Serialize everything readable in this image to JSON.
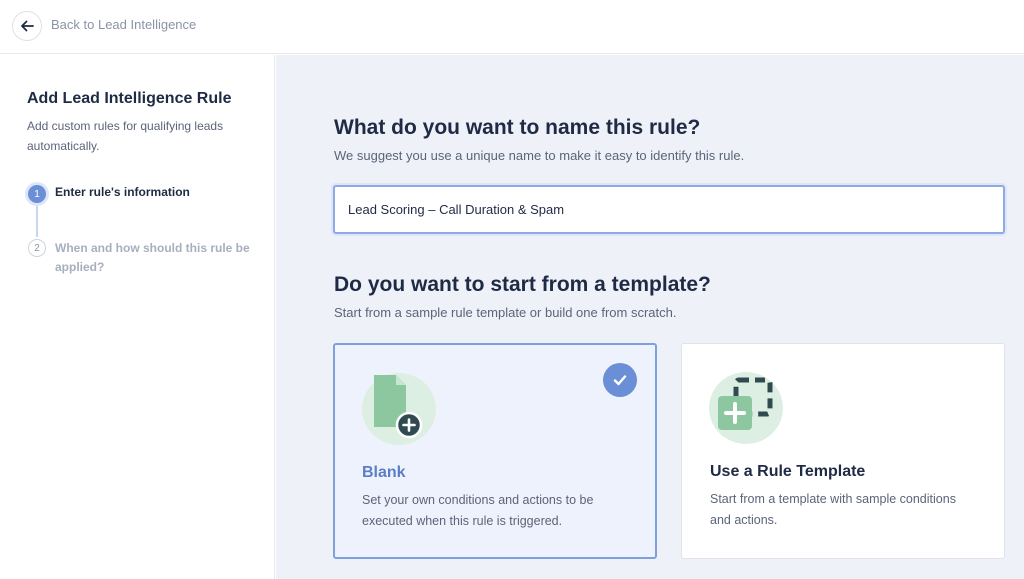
{
  "header": {
    "back_icon": "arrow-left-icon",
    "back_label": "Back to Lead Intelligence"
  },
  "sidebar": {
    "title": "Add Lead Intelligence Rule",
    "subtitle": "Add custom rules for qualifying leads automatically.",
    "steps": [
      {
        "number": "1",
        "label": "Enter rule's information",
        "state": "active"
      },
      {
        "number": "2",
        "label": "When and how should this rule be applied?",
        "state": "inactive"
      }
    ]
  },
  "main": {
    "name_section": {
      "heading": "What do you want to name this rule?",
      "description": "We suggest you use a unique name to make it easy to identify this rule.",
      "input_value": "Lead Scoring – Call Duration & Spam"
    },
    "template_section": {
      "heading": "Do you want to start from a template?",
      "description": "Start from a sample rule template or build one from scratch.",
      "options": [
        {
          "title": "Blank",
          "description": "Set your own conditions and actions to be executed when this rule is triggered.",
          "selected": true,
          "icon": "blank-document-plus-icon"
        },
        {
          "title": "Use a Rule Template",
          "description": "Start from a template with sample conditions and actions.",
          "selected": false,
          "icon": "template-plus-icon"
        }
      ]
    }
  },
  "colors": {
    "accent": "#6b8fd6",
    "accent_text": "#5b7ec7",
    "main_bg": "#eef1f8",
    "illustration_green": "#8cc7a0",
    "illustration_dark": "#2f4b50"
  }
}
